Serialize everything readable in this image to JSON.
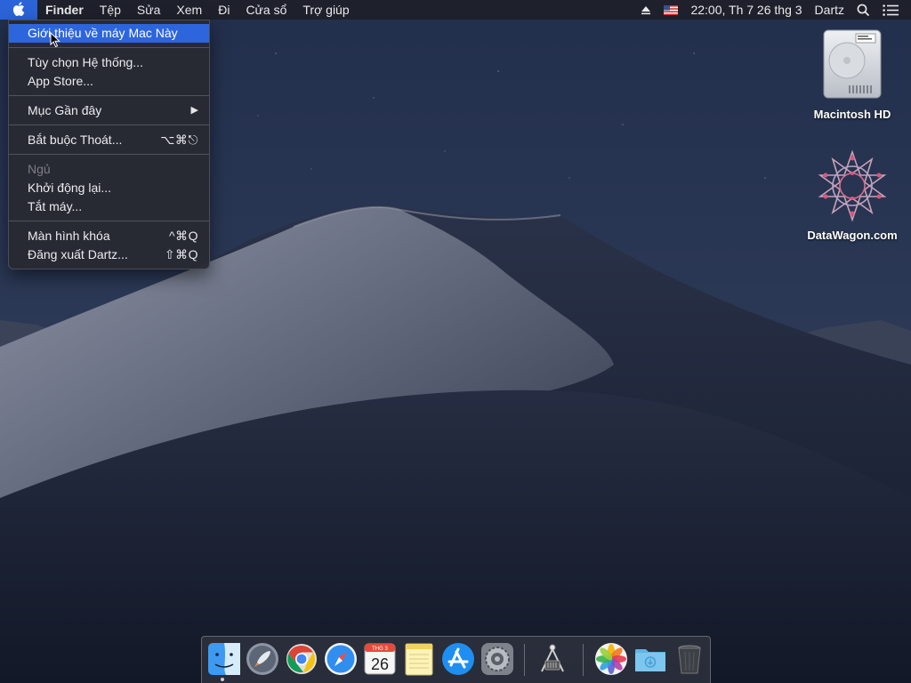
{
  "menubar": {
    "apple_icon": "apple-logo-icon",
    "app_name": "Finder",
    "menus": [
      "Tệp",
      "Sửa",
      "Xem",
      "Đi",
      "Cửa sổ",
      "Trợ giúp"
    ],
    "status": {
      "eject_icon": "eject-icon",
      "flag_icon": "us-flag-icon",
      "clock": "22:00, Th 7 26 thg 3",
      "user": "Dartz",
      "search_icon": "spotlight-search-icon",
      "notification_icon": "notification-center-icon"
    }
  },
  "apple_menu": {
    "about": "Giới thiệu về máy Mac Này",
    "preferences": "Tùy chọn Hệ thống...",
    "app_store": "App Store...",
    "recent": "Mục Gần đây",
    "force_quit": "Bắt buộc Thoát...",
    "force_quit_shortcut": "⌥⌘⎋",
    "sleep": "Ngủ",
    "restart": "Khởi động lại...",
    "shutdown": "Tắt máy...",
    "lock": "Màn hình khóa",
    "lock_shortcut": "^⌘Q",
    "logout": "Đăng xuất Dartz...",
    "logout_shortcut": "⇧⌘Q"
  },
  "desktop_icons": {
    "hd_label": "Macintosh HD",
    "datawagon_label": "DataWagon.com"
  },
  "dock": {
    "apps": [
      "Finder",
      "Launchpad",
      "Google Chrome",
      "Safari",
      "Calendar",
      "Notes",
      "App Store",
      "System Preferences",
      "Directory Utility",
      "Photos",
      "Downloads",
      "Trash"
    ],
    "calendar_month": "THG 3",
    "calendar_day": "26"
  },
  "colors": {
    "highlight": "#2d66dc",
    "menubar_bg": "#1e2028",
    "wallpaper_sky": "#1e2a44"
  }
}
